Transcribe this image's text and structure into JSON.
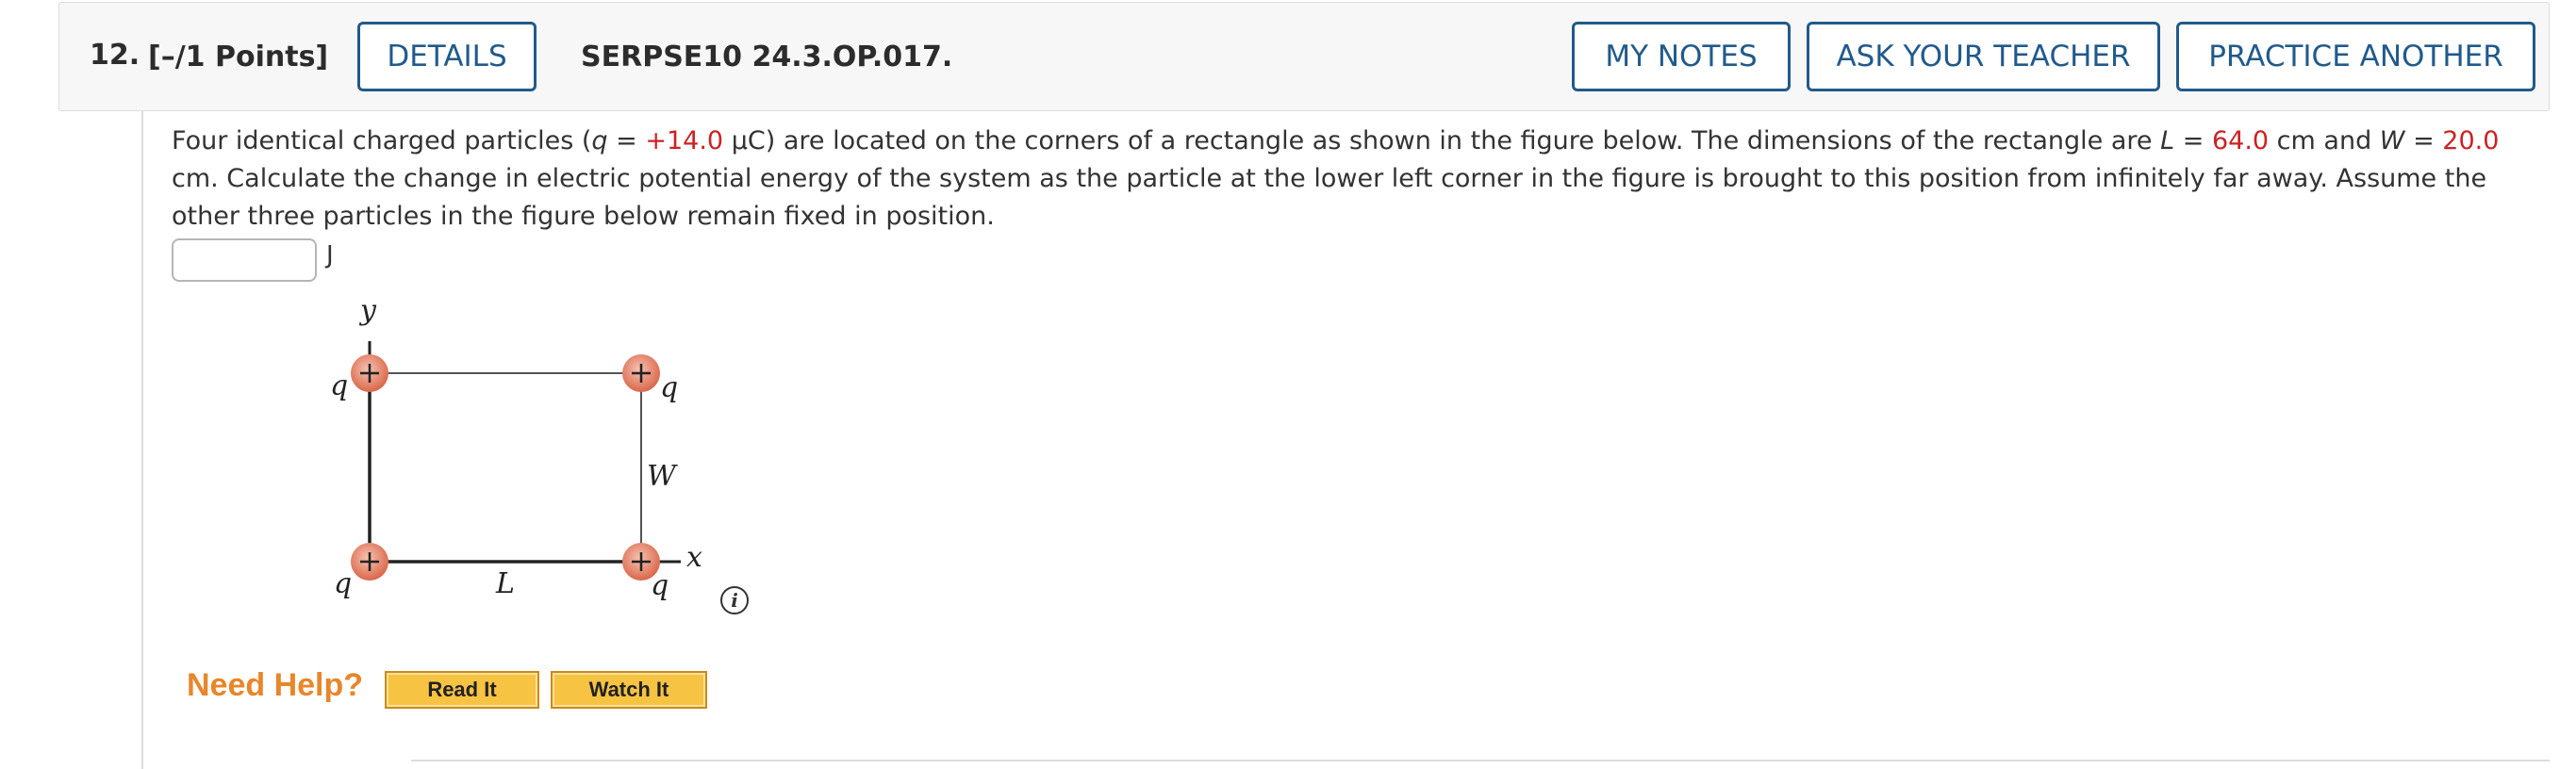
{
  "header": {
    "number": "12.",
    "points": "[–/1 Points]",
    "details_label": "DETAILS",
    "reference": "SERPSE10 24.3.OP.017.",
    "my_notes_label": "MY NOTES",
    "ask_teacher_label": "ASK YOUR TEACHER",
    "practice_another_label": "PRACTICE ANOTHER"
  },
  "question": {
    "part1": "Four identical charged particles (",
    "q_symbol": "q",
    "eq1": " = ",
    "q_value": "+14.0",
    "q_unit": " μC) are located on the corners of a rectangle as shown in the figure below. The dimensions of the rectangle are ",
    "L_symbol": "L",
    "eq2": " = ",
    "L_value": "64.0",
    "L_unit_and": " cm and ",
    "W_symbol": "W",
    "eq3": " = ",
    "W_value": "20.0",
    "part2": " cm. Calculate the change in electric potential energy of the system as the particle at the lower left corner in the figure is brought to this position from infinitely far away. Assume the other three particles in the figure below remain fixed in position."
  },
  "answer": {
    "value": "",
    "unit": "J"
  },
  "figure": {
    "y_axis_label": "y",
    "x_axis_label": "x",
    "charge_label_top_left": "q",
    "charge_label_top_right": "q",
    "charge_label_bottom_left": "q",
    "charge_label_bottom_right": "q",
    "length_label": "L",
    "width_label": "W",
    "charge_sign": "+",
    "charge_color": "#e07a5f"
  },
  "info_icon_glyph": "i",
  "help": {
    "title": "Need Help?",
    "read_it_label": "Read It",
    "watch_it_label": "Watch It"
  },
  "colors": {
    "button_border": "#215a8b",
    "highlight_value": "#cc2222",
    "need_help": "#e8862a",
    "help_button": "#f7c343"
  }
}
